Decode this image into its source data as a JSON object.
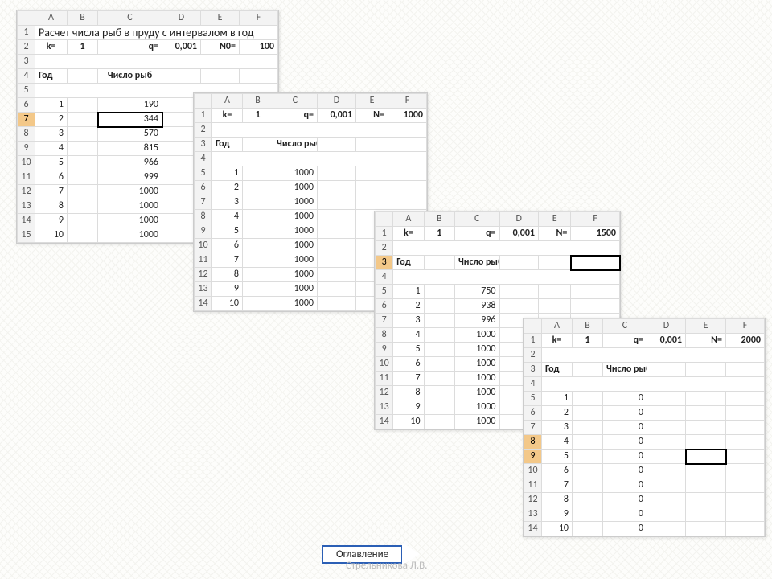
{
  "cols": [
    "A",
    "B",
    "C",
    "D",
    "E",
    "F"
  ],
  "t1": {
    "title": "Расчет числа рыб в пруду с интервалом в год",
    "p": {
      "k": "k=",
      "kv": "1",
      "q": "q=",
      "qv": "0,001",
      "n": "N0=",
      "nv": "100"
    },
    "h": {
      "y": "Год",
      "f": "Число рыб"
    },
    "rows": [
      {
        "r": "1"
      },
      {
        "r": "2"
      },
      {
        "r": "3"
      },
      {
        "r": "4"
      },
      {
        "r": "5"
      },
      {
        "r": "6",
        "y": "1",
        "v": "190"
      },
      {
        "r": "7",
        "y": "2",
        "v": "344",
        "sel": true,
        "rsel": true
      },
      {
        "r": "8",
        "y": "3",
        "v": "570"
      },
      {
        "r": "9",
        "y": "4",
        "v": "815"
      },
      {
        "r": "10",
        "y": "5",
        "v": "966"
      },
      {
        "r": "11",
        "y": "6",
        "v": "999"
      },
      {
        "r": "12",
        "y": "7",
        "v": "1000"
      },
      {
        "r": "13",
        "y": "8",
        "v": "1000"
      },
      {
        "r": "14",
        "y": "9",
        "v": "1000"
      },
      {
        "r": "15",
        "y": "10",
        "v": "1000"
      }
    ]
  },
  "t2": {
    "p": {
      "k": "k=",
      "kv": "1",
      "q": "q=",
      "qv": "0,001",
      "n": "N=",
      "nv": "1000"
    },
    "h": {
      "y": "Год",
      "f": "Число рыб"
    },
    "rows": [
      {
        "r": "1"
      },
      {
        "r": "2"
      },
      {
        "r": "3"
      },
      {
        "r": "4"
      },
      {
        "r": "5",
        "y": "1",
        "v": "1000"
      },
      {
        "r": "6",
        "y": "2",
        "v": "1000"
      },
      {
        "r": "7",
        "y": "3",
        "v": "1000"
      },
      {
        "r": "8",
        "y": "4",
        "v": "1000"
      },
      {
        "r": "9",
        "y": "5",
        "v": "1000"
      },
      {
        "r": "10",
        "y": "6",
        "v": "1000"
      },
      {
        "r": "11",
        "y": "7",
        "v": "1000"
      },
      {
        "r": "12",
        "y": "8",
        "v": "1000"
      },
      {
        "r": "13",
        "y": "9",
        "v": "1000"
      },
      {
        "r": "14",
        "y": "10",
        "v": "1000"
      }
    ]
  },
  "t3": {
    "p": {
      "k": "k=",
      "kv": "1",
      "q": "q=",
      "qv": "0,001",
      "n": "N=",
      "nv": "1500"
    },
    "h": {
      "y": "Год",
      "f": "Число рыб"
    },
    "selCol": "F",
    "rows": [
      {
        "r": "1"
      },
      {
        "r": "2"
      },
      {
        "r": "3",
        "rsel": true,
        "selF": true
      },
      {
        "r": "4"
      },
      {
        "r": "5",
        "y": "1",
        "v": "750"
      },
      {
        "r": "6",
        "y": "2",
        "v": "938"
      },
      {
        "r": "7",
        "y": "3",
        "v": "996"
      },
      {
        "r": "8",
        "y": "4",
        "v": "1000"
      },
      {
        "r": "9",
        "y": "5",
        "v": "1000"
      },
      {
        "r": "10",
        "y": "6",
        "v": "1000"
      },
      {
        "r": "11",
        "y": "7",
        "v": "1000"
      },
      {
        "r": "12",
        "y": "8",
        "v": "1000"
      },
      {
        "r": "13",
        "y": "9",
        "v": "1000"
      },
      {
        "r": "14",
        "y": "10",
        "v": "1000"
      }
    ]
  },
  "t4": {
    "p": {
      "k": "k=",
      "kv": "1",
      "q": "q=",
      "qv": "0,001",
      "n": "N=",
      "nv": "2000"
    },
    "h": {
      "y": "Год",
      "f": "Число рыб"
    },
    "selCol": "E",
    "rows": [
      {
        "r": "1"
      },
      {
        "r": "2"
      },
      {
        "r": "3"
      },
      {
        "r": "4"
      },
      {
        "r": "5",
        "y": "1",
        "v": "0"
      },
      {
        "r": "6",
        "y": "2",
        "v": "0"
      },
      {
        "r": "7",
        "y": "3",
        "v": "0"
      },
      {
        "r": "8",
        "y": "4",
        "v": "0",
        "rsel": true
      },
      {
        "r": "9",
        "y": "5",
        "v": "0",
        "rsel": true,
        "selE": true
      },
      {
        "r": "10",
        "y": "6",
        "v": "0"
      },
      {
        "r": "11",
        "y": "7",
        "v": "0"
      },
      {
        "r": "12",
        "y": "8",
        "v": "0"
      },
      {
        "r": "13",
        "y": "9",
        "v": "0"
      },
      {
        "r": "14",
        "y": "10",
        "v": "0"
      }
    ]
  },
  "toc": "Оглавление",
  "credit": "Стрельникова Л.В."
}
